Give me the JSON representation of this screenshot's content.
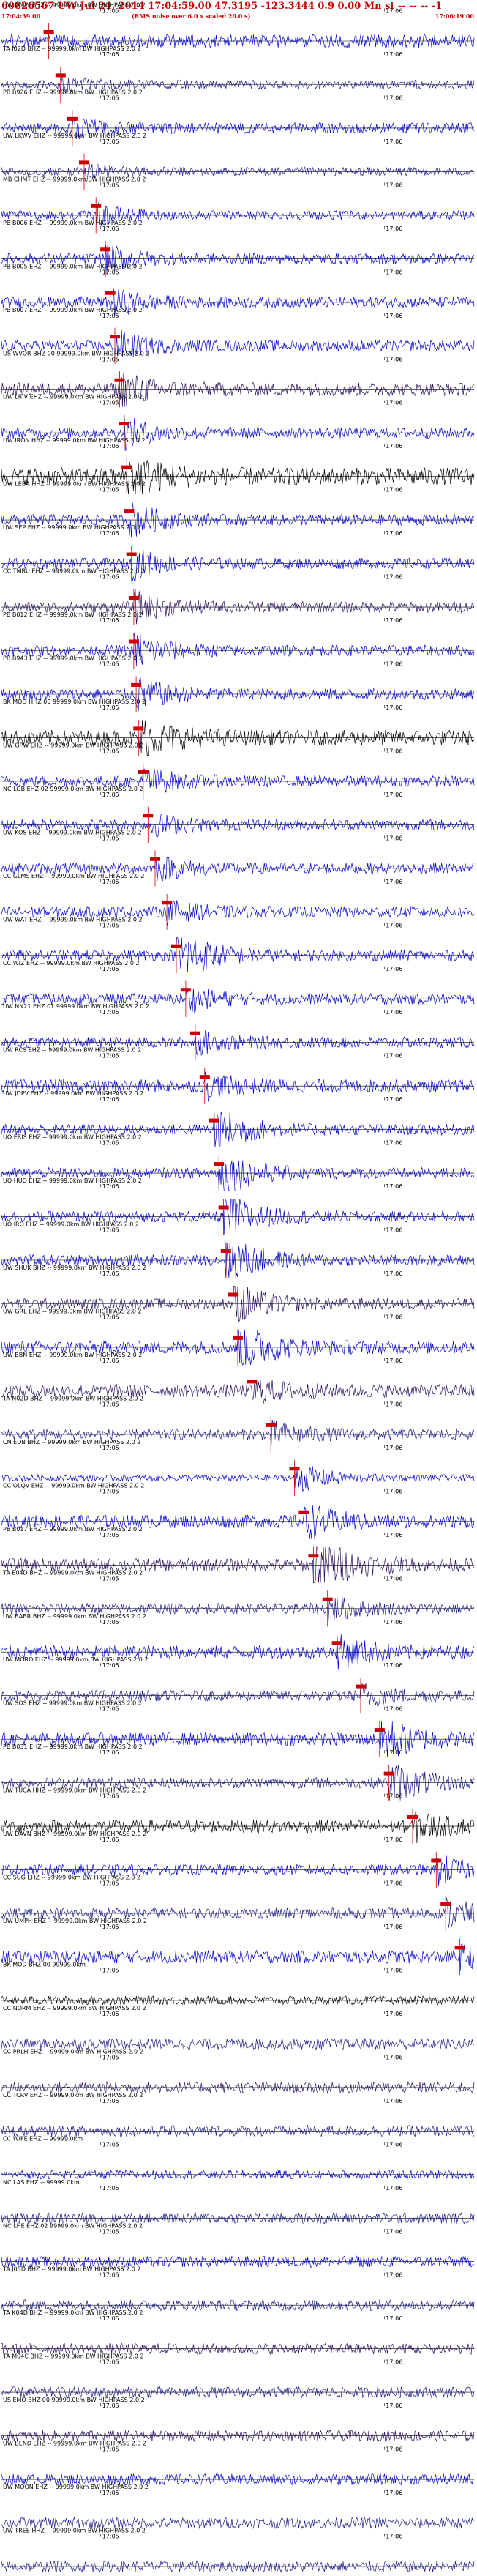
{
  "header": {
    "title": "60826567 UW Jul 24, 2014 17:04:59.00   47.3195 -123.3444  0.9 0.00 Mn st -- -- -- -1",
    "start_time": "17:04:39.00",
    "note": "(RMS noise over 6.0 x scaled 20.0 s)",
    "end_time": "17:06:19.00"
  },
  "colors": {
    "title": "#cc0000",
    "pick_marker": "#cc0000",
    "baseline": "#000000",
    "trace_palette": [
      "#0000cc",
      "#1a1a8a",
      "#2a1060",
      "#000000",
      "#3333cc"
    ]
  },
  "chart_data": {
    "type": "line",
    "xlabel": "",
    "ylabel": "",
    "x_tick_labels": [
      "17:05",
      "17:06"
    ],
    "x_ticks_seconds": [
      21,
      81
    ],
    "xlim_seconds": [
      0,
      100
    ],
    "series": [
      {
        "name": "UW DMW BHZ -- 99999.0km BW HIGHPASS 2.0 2",
        "color": "#0000cc",
        "amp": 0.6,
        "pick": 10.0,
        "event": 0.0
      },
      {
        "name": "TA I02D BHZ -- 99999.0km BW HIGHPASS 2.0 2",
        "color": "#1a1a8a",
        "amp": 0.4,
        "pick": 12.5,
        "event": 0.5
      },
      {
        "name": "PB B926 EHZ -- 99999.0km BW HIGHPASS 2.0 2",
        "color": "#0000cc",
        "amp": 0.5,
        "pick": 15.0,
        "event": 0.6
      },
      {
        "name": "UW LKWV EHZ -- 99999.0km BW HIGHPASS 2.0 2",
        "color": "#1a1a8a",
        "amp": 0.4,
        "pick": 17.5,
        "event": 0.6
      },
      {
        "name": "MB CHMT EHZ -- 99999.0km BW HIGHPASS 2.0 2",
        "color": "#0000cc",
        "amp": 0.4,
        "pick": 20.0,
        "event": 0.7
      },
      {
        "name": "PB B006 EHZ -- 99999.0km BW HIGHPASS 2.0 2",
        "color": "#0000cc",
        "amp": 0.5,
        "pick": 22.0,
        "event": 0.9
      },
      {
        "name": "PB B005 EHZ -- 99999.0km BW HIGHPASS 2.0 2",
        "color": "#0000cc",
        "amp": 0.5,
        "pick": 23.0,
        "event": 0.9
      },
      {
        "name": "PB B007 EHZ -- 99999.0km BW HIGHPASS 2.0 2",
        "color": "#0000cc",
        "amp": 0.5,
        "pick": 24.0,
        "event": 1.0
      },
      {
        "name": "US WVOR BHZ 00 99999.0km BW HIGHPASS 2.0 2",
        "color": "#2a1060",
        "amp": 0.6,
        "pick": 25.0,
        "event": 1.2
      },
      {
        "name": "UW LRIV EHZ -- 99999.0km BW HIGHPASS 2.0 2",
        "color": "#0000cc",
        "amp": 0.5,
        "pick": 26.0,
        "event": 1.0
      },
      {
        "name": "UW IRON HHZ -- 99999.0km BW HIGHPASS 2.0 2",
        "color": "#000000",
        "amp": 0.8,
        "pick": 26.5,
        "event": 1.6
      },
      {
        "name": "UW LEBA HHZ -- 99999.0km BW HIGHPASS 2.0 2",
        "color": "#0000cc",
        "amp": 0.5,
        "pick": 27.0,
        "event": 1.2
      },
      {
        "name": "UW SEP EHZ -- 99999.0km BW HIGHPASS 2.0 2",
        "color": "#0000cc",
        "amp": 0.5,
        "pick": 27.5,
        "event": 1.0
      },
      {
        "name": "CC TMBU EHZ -- 99999.0km BW HIGHPASS 2.0 2",
        "color": "#2a1060",
        "amp": 0.5,
        "pick": 28.0,
        "event": 1.0
      },
      {
        "name": "PB B012 EHZ -- 99999.0km BW HIGHPASS 2.0 2",
        "color": "#0000cc",
        "amp": 0.5,
        "pick": 28.0,
        "event": 1.4
      },
      {
        "name": "PB B943 EHZ -- 99999.0km BW HIGHPASS 2.0 2",
        "color": "#0000cc",
        "amp": 0.5,
        "pick": 28.5,
        "event": 1.2
      },
      {
        "name": "BK MOD HHZ 00 99999.0km BW HIGHPASS 2.0 2",
        "color": "#000000",
        "amp": 0.7,
        "pick": 29.0,
        "event": 1.5
      },
      {
        "name": "UW GPW EHZ -- 99999.0km BW HIGHPASS 2.0 2",
        "color": "#0000cc",
        "amp": 0.5,
        "pick": 30.0,
        "event": 1.0
      },
      {
        "name": "NC LOB EHZ 02 99999.0km BW HIGHPASS 2.0 2",
        "color": "#0000cc",
        "amp": 0.5,
        "pick": 31.0,
        "event": 0.8
      },
      {
        "name": "UW KOS EHZ -- 99999.0km BW HIGHPASS 2.0 2",
        "color": "#0000cc",
        "amp": 0.5,
        "pick": 32.5,
        "event": 0.8
      },
      {
        "name": "CC GLMS EHZ -- 99999.0km BW HIGHPASS 2.0 2",
        "color": "#0000cc",
        "amp": 0.5,
        "pick": 35.0,
        "event": 0.7
      },
      {
        "name": "UW WAT EHZ -- 99999.0km BW HIGHPASS 2.0 2",
        "color": "#0000cc",
        "amp": 0.5,
        "pick": 37.0,
        "event": 2.2
      },
      {
        "name": "CC WIZ EHZ -- 99999.0km BW HIGHPASS 2.0 2",
        "color": "#0000cc",
        "amp": 0.5,
        "pick": 39.0,
        "event": 0.8
      },
      {
        "name": "UW NN21 EHZ 01 99999.0km BW HIGHPASS 2.0 2",
        "color": "#0000cc",
        "amp": 0.5,
        "pick": 41.0,
        "event": 0.7
      },
      {
        "name": "UW RCS EHZ -- 99999.0km BW HIGHPASS 2.0 2",
        "color": "#0000cc",
        "amp": 0.6,
        "pick": 43.0,
        "event": 0.8
      },
      {
        "name": "UW JDPV EHZ -- 99999.0km BW HIGHPASS 2.0 2",
        "color": "#0000cc",
        "amp": 0.5,
        "pick": 45.0,
        "event": 1.8
      },
      {
        "name": "UO ERIS EHZ -- 99999.0km BW HIGHPASS 2.0 2",
        "color": "#0000cc",
        "amp": 0.5,
        "pick": 46.0,
        "event": 1.8
      },
      {
        "name": "UO HUO EHZ -- 99999.0km BW HIGHPASS 2.0 2",
        "color": "#0000cc",
        "amp": 0.5,
        "pick": 47.0,
        "event": 1.8
      },
      {
        "name": "UO IRO EHZ -- 99999.0km BW HIGHPASS 2.0 2",
        "color": "#0000cc",
        "amp": 0.5,
        "pick": 47.5,
        "event": 1.8
      },
      {
        "name": "UW SHUK BHZ -- 99999.0km BW HIGHPASS 2.0 2",
        "color": "#2a1060",
        "amp": 0.5,
        "pick": 49.0,
        "event": 1.6
      },
      {
        "name": "UW GRL EHZ -- 99999.0km BW HIGHPASS 2.0 2",
        "color": "#0000cc",
        "amp": 0.6,
        "pick": 50.0,
        "event": 2.0
      },
      {
        "name": "UW BBN EHZ -- 99999.0km BW HIGHPASS 2.0 2",
        "color": "#2a1060",
        "amp": 0.6,
        "pick": 53.0,
        "event": 0.8
      },
      {
        "name": "TA N02D BHZ -- 99999.0km BW HIGHPASS 2.0 2",
        "color": "#1a1a8a",
        "amp": 0.5,
        "pick": 57.0,
        "event": 0.8
      },
      {
        "name": "CN EDB BHZ -- 99999.0km BW HIGHPASS 2.0 2",
        "color": "#0000cc",
        "amp": 0.3,
        "pick": 62.0,
        "event": 1.2
      },
      {
        "name": "CC OLQV EHZ -- 99999.0km BW HIGHPASS 2.0 2",
        "color": "#0000cc",
        "amp": 0.6,
        "pick": 64.0,
        "event": 1.2
      },
      {
        "name": "PB B017 EHZ -- 99999.0km BW HIGHPASS 2.0 2",
        "color": "#2a1060",
        "amp": 0.6,
        "pick": 66.0,
        "event": 2.4
      },
      {
        "name": "TA E04D BHZ -- 99999.0km BW HIGHPASS 2.0 2",
        "color": "#1a1a8a",
        "amp": 0.5,
        "pick": 69.0,
        "event": 0.8
      },
      {
        "name": "UW BABR BHZ -- 99999.0km BW HIGHPASS 2.0 2",
        "color": "#0000cc",
        "amp": 0.6,
        "pick": 71.0,
        "event": 1.2
      },
      {
        "name": "UW MORO EHZ -- 99999.0km BW HIGHPASS 2.0 2",
        "color": "#1a1a8a",
        "amp": 0.5,
        "pick": 76.0,
        "event": 0.8
      },
      {
        "name": "UW SOS EHZ -- 99999.0km BW HIGHPASS 2.0 2",
        "color": "#0000cc",
        "amp": 0.6,
        "pick": 80.0,
        "event": 1.8
      },
      {
        "name": "PB B031 EHZ -- 99999.0km BW HIGHPASS 2.0 2",
        "color": "#1a1a8a",
        "amp": 0.5,
        "pick": 82.0,
        "event": 1.6
      },
      {
        "name": "UW TUCA HHZ -- 99999.0km BW HIGHPASS 2.0 2",
        "color": "#000000",
        "amp": 0.6,
        "pick": 87.0,
        "event": 1.0
      },
      {
        "name": "UW DAVN BHZ -- 99999.0km BW HIGHPASS 2.0 2",
        "color": "#0000cc",
        "amp": 0.5,
        "pick": 92.0,
        "event": 1.0
      },
      {
        "name": "CC SUG EHZ -- 99999.0km BW HIGHPASS 2.0 2",
        "color": "#1a1a8a",
        "amp": 0.5,
        "pick": 94.0,
        "event": 1.0
      },
      {
        "name": "UW UMPH EHZ -- 99999.0km BW HIGHPASS 2.0 2",
        "color": "#0000cc",
        "amp": 0.6,
        "pick": 97.0,
        "event": 0.6
      },
      {
        "name": "BK MOD BHZ 00 99999.0km",
        "color": "#000000",
        "amp": 0.4,
        "pick": null,
        "event": 0.0
      },
      {
        "name": "CC NORM EHZ -- 99999.0km BW HIGHPASS 2.0 2",
        "color": "#1a1a8a",
        "amp": 0.5,
        "pick": null,
        "event": 0.0
      },
      {
        "name": "CC PRLH EHZ -- 99999.0km BW HIGHPASS 2.0 2",
        "color": "#2a1060",
        "amp": 0.5,
        "pick": null,
        "event": 0.0
      },
      {
        "name": "CC TCRV EHZ -- 99999.0km BW HIGHPASS 2.0 2",
        "color": "#1a1a8a",
        "amp": 0.5,
        "pick": null,
        "event": 0.0
      },
      {
        "name": "CC WIFE EHZ -- 99999.0km",
        "color": "#0000cc",
        "amp": 0.4,
        "pick": null,
        "event": 0.0
      },
      {
        "name": "NC LAS EHZ -- 99999.0km",
        "color": "#1a1a8a",
        "amp": 0.5,
        "pick": null,
        "event": 0.0
      },
      {
        "name": "NC LHE EHZ 02 99999.0km BW HIGHPASS 2.0 2",
        "color": "#0000cc",
        "amp": 0.5,
        "pick": null,
        "event": 0.0
      },
      {
        "name": "TA J05D BHZ -- 99999.0km BW HIGHPASS 2.0 2",
        "color": "#1a1a8a",
        "amp": 0.5,
        "pick": null,
        "event": 0.0
      },
      {
        "name": "TA K04D BHZ -- 99999.0km BW HIGHPASS 2.0 2",
        "color": "#2a1060",
        "amp": 0.5,
        "pick": null,
        "event": 0.0
      },
      {
        "name": "TA M04C BHZ -- 99999.0km BW HIGHPASS 2.0 2",
        "color": "#1a1a8a",
        "amp": 0.5,
        "pick": null,
        "event": 0.0
      },
      {
        "name": "US EMO BHZ 00 99999.0km BW HIGHPASS 2.0 2",
        "color": "#2a1060",
        "amp": 0.5,
        "pick": null,
        "event": 0.0
      },
      {
        "name": "UW BEND EHZ -- 99999.0km BW HIGHPASS 2.0 2",
        "color": "#0000cc",
        "amp": 0.5,
        "pick": null,
        "event": 0.0
      },
      {
        "name": "UW MOON EHZ -- 99999.0km BW HIGHPASS 2.0 2",
        "color": "#1a1a8a",
        "amp": 0.5,
        "pick": null,
        "event": 0.0
      },
      {
        "name": "UW TREE HHZ -- 99999.0km BW HIGHPASS 2.0 2",
        "color": "#1a1a8a",
        "amp": 0.5,
        "pick": null,
        "event": 0.0
      }
    ]
  }
}
